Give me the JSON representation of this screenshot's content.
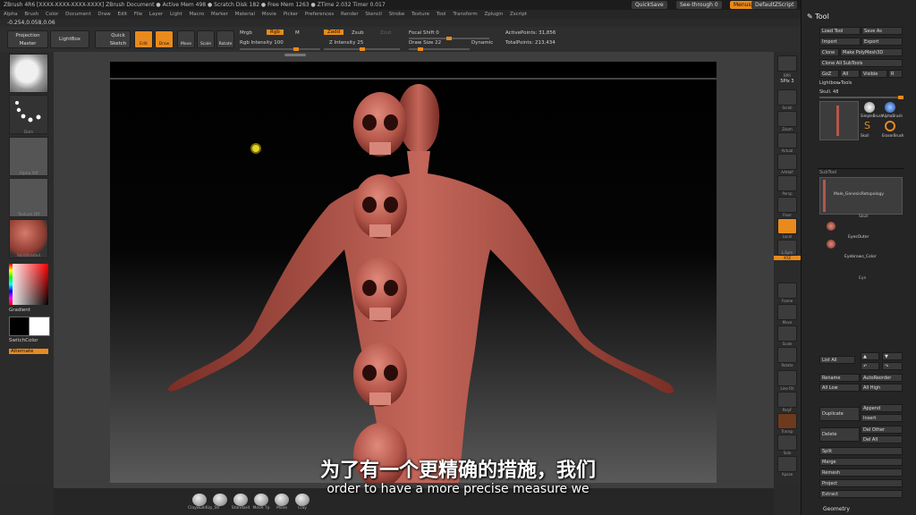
{
  "titlebar": {
    "app_info": "ZBrush 4R6 [XXXX-XXXX-XXXX-XXXX]   ZBrush Document    ● Active Mem 498 ● Scratch Disk 182 ● Free Mem 1263 ● ZTime 2.032 Timer 0.017",
    "quicksave": "QuickSave",
    "seethrough": "See-through  0",
    "menus": "Menus",
    "defaultscript": "DefaultZScript"
  },
  "menubar": [
    "Alpha",
    "Brush",
    "Color",
    "Document",
    "Draw",
    "Edit",
    "File",
    "Layer",
    "Light",
    "Macro",
    "Marker",
    "Material",
    "Movie",
    "Picker",
    "Preferences",
    "Render",
    "Stencil",
    "Stroke",
    "Texture",
    "Tool",
    "Transform",
    "Zplugin",
    "Zscript"
  ],
  "coords": "-0.254,0.058,0.06",
  "toolbar": {
    "projection_master": "Projection Master",
    "lightbox": "LightBox",
    "quick_sketch": "Quick Sketch",
    "edit": "Edit",
    "draw": "Draw",
    "move": "Move",
    "scale": "Scale",
    "rotate": "Rotate",
    "mrgb": "Mrgb",
    "rgb": "Rgb",
    "m": "M",
    "zadd": "Zadd",
    "zsub": "Zsub",
    "zcut": "Zcut",
    "rgb_intensity": "Rgb Intensity 100",
    "z_intensity": "Z Intensity 25",
    "focal_shift": "Focal Shift 0",
    "draw_size": "Draw Size 22",
    "dynamic": "Dynamic",
    "active_points": "ActivePoints: 31,856",
    "total_points": "TotalPoints: 213,434"
  },
  "left_shelf": {
    "brush": "Standard",
    "stroke": "Dots",
    "alpha": "Alpha Off",
    "texture": "Texture Off",
    "material": "SkinShade4",
    "gradient": "Gradient",
    "switch_color": "SwitchColor",
    "alternate": "Alternate"
  },
  "right_shelf": [
    "BPR",
    "SPix 3",
    "Scroll",
    "Zoom",
    "Actual",
    "AAHalf",
    "Persp",
    "Floor",
    "Local",
    "L.Sym",
    "XYZ",
    "Frame",
    "Move",
    "Scale",
    "Rotate",
    "Line Fill",
    "PolyF",
    "Transp",
    "Solo",
    "Xpose"
  ],
  "tool_panel": {
    "title": "Tool",
    "load_tool": "Load Tool",
    "save_as": "Save As",
    "import": "Import",
    "export": "Export",
    "clone": "Clone",
    "make_polymesh": "Make PolyMesh3D",
    "clone_all": "Clone All SubTools",
    "goz": "GoZ",
    "all": "All",
    "visible": "Visible",
    "r": "R",
    "lightbox_tools": "Lightbox▸Tools",
    "skull_count": "Skull. 48",
    "tool_thumbs": [
      "SimpleBrush",
      "AlphaBrush",
      "Skull",
      "EraserBrush"
    ],
    "subtool": "SubTool",
    "subtools": [
      "Male_GenesisRetopology",
      "Skull",
      "EyesOuter",
      "Eyebrows_Color",
      "Eye"
    ],
    "list_all": "List All",
    "rename": "Rename",
    "autoreorder": "AutoReorder",
    "all_low": "All Low",
    "all_high": "All High",
    "duplicate": "Duplicate",
    "append": "Append",
    "insert": "Insert",
    "delete": "Delete",
    "del_other": "Del Other",
    "del_all": "Del All",
    "split": "Split",
    "merge": "Merge",
    "remesh": "Remesh",
    "project": "Project",
    "extract": "Extract",
    "geometry": "Geometry"
  },
  "bottom_bar": [
    "ClayBuildUp_Str",
    "Standard",
    "Move Tp",
    "Move",
    "Clay"
  ],
  "subtitles": {
    "zh": "为了有一个更精确的措施，我们",
    "en": "order to have a more precise measure we"
  },
  "colors": {
    "accent": "#e98a1c",
    "skin": "#b5564a"
  }
}
